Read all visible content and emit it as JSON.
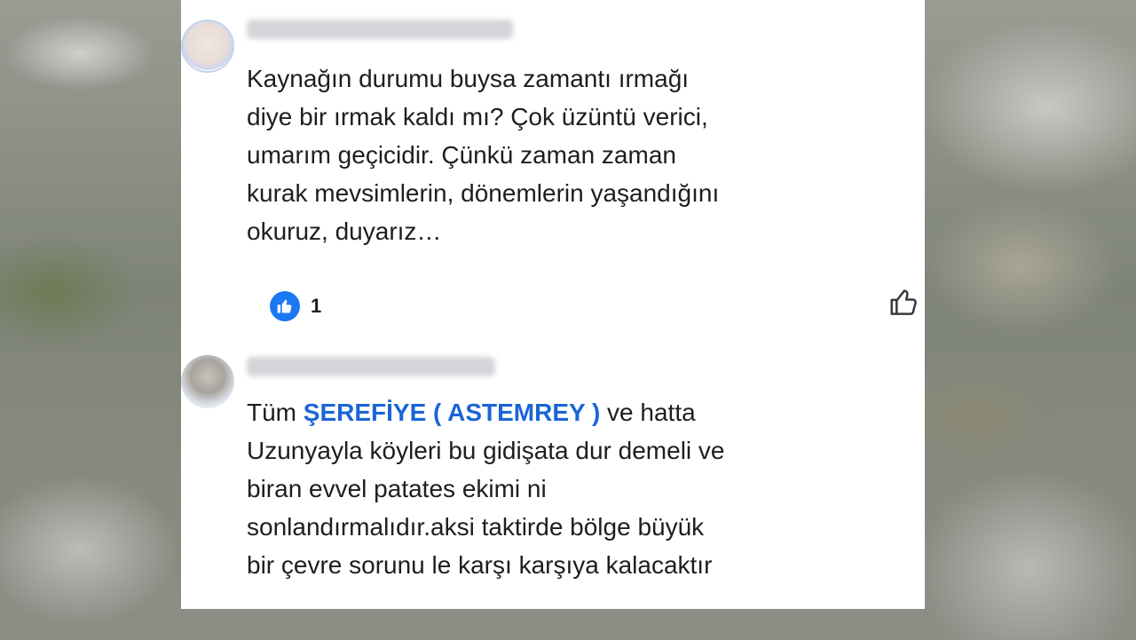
{
  "comments": [
    {
      "text": "Kaynağın durumu buysa zamantı ırmağı\ndiye bir ırmak kaldı mı? Çok üzüntü verici,\numarım geçicidir. Çünkü zaman zaman\nkurak mevsimlerin, dönemlerin yaşandığını\nokuruz, duyarız…",
      "reaction_count": "1"
    },
    {
      "prefix": "Tüm ",
      "mention": "ŞEREFİYE ( ASTEMREY )",
      "text": " ve hatta\nUzunyayla köyleri bu gidişata dur demeli ve\nbiran evvel patates ekimi ni\nsonlandırmalıdır.aksi taktirde bölge büyük\nbir çevre sorunu le karşı karşıya kalacaktır"
    }
  ],
  "icons": {
    "reaction_badge": "thumbs-up-icon",
    "like_button": "like-outline-icon"
  },
  "colors": {
    "mention": "#1b65d6",
    "reaction_badge": "#1a78f2"
  }
}
